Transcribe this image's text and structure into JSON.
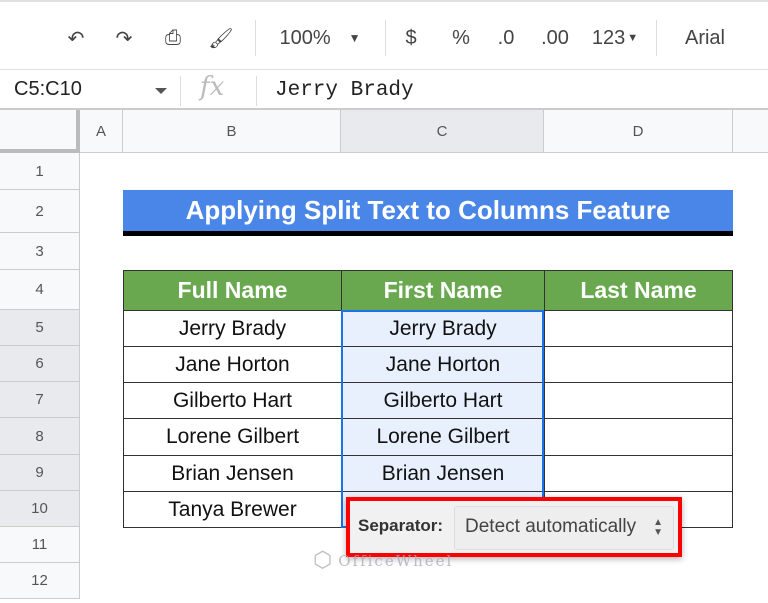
{
  "toolbar": {
    "zoom": "100%",
    "currency": "$",
    "percent": "%",
    "dec_decrease": ".0",
    "dec_increase": ".00",
    "more_formats": "123",
    "font": "Arial"
  },
  "formula_bar": {
    "name_box": "C5:C10",
    "fx": "fx",
    "value": "Jerry Brady"
  },
  "columns": [
    "A",
    "B",
    "C",
    "D"
  ],
  "rows": [
    "1",
    "2",
    "3",
    "4",
    "5",
    "6",
    "7",
    "8",
    "9",
    "10",
    "11",
    "12"
  ],
  "sheet": {
    "title": "Applying Split Text to Columns Feature",
    "headers": [
      "Full Name",
      "First Name",
      "Last Name"
    ],
    "full_names": [
      "Jerry Brady",
      "Jane Horton",
      "Gilberto Hart",
      "Lorene Gilbert",
      "Brian Jensen",
      "Tanya Brewer"
    ],
    "first_names": [
      "Jerry Brady",
      "Jane Horton",
      "Gilberto Hart",
      "Lorene Gilbert",
      "Brian Jensen",
      ""
    ]
  },
  "separator_popup": {
    "label": "Separator:",
    "value": "Detect automatically"
  },
  "watermark": "OfficeWheel"
}
